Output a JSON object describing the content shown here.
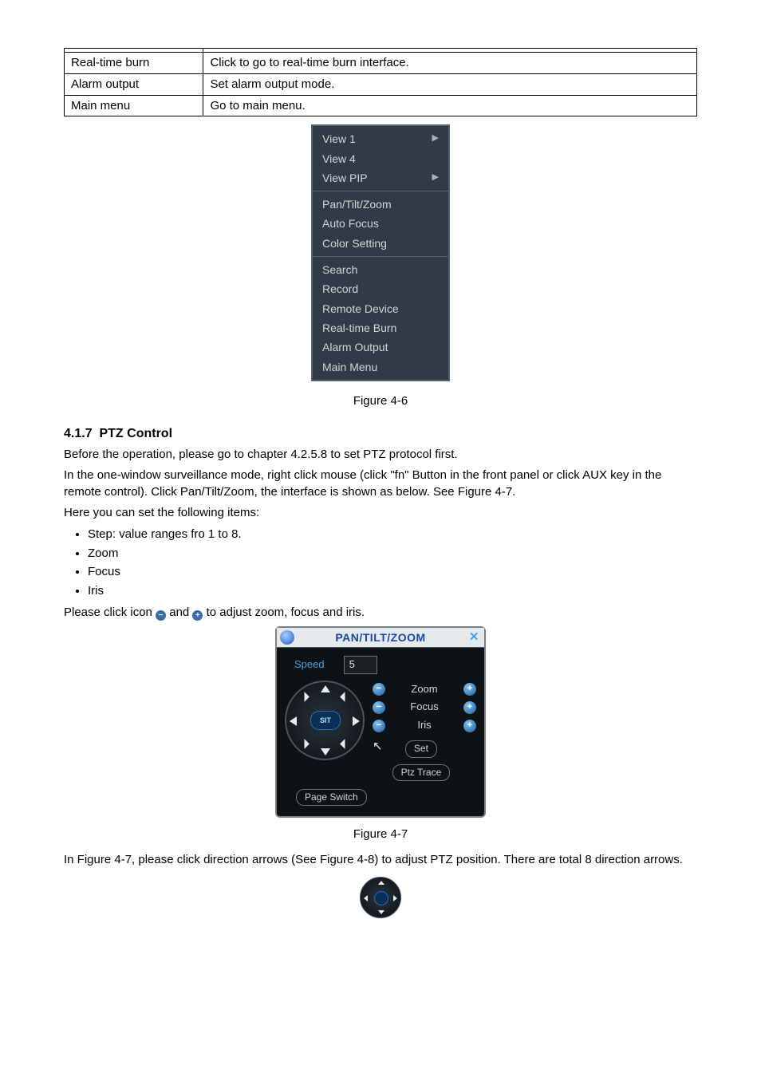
{
  "table": {
    "rows": [
      {
        "name": "Real-time burn",
        "desc": "Click to go to real-time burn interface."
      },
      {
        "name": "Alarm output",
        "desc": "Set alarm output mode."
      },
      {
        "name": "Main menu",
        "desc": "Go to main menu."
      }
    ]
  },
  "context_menu": {
    "groups": [
      [
        {
          "label": "View 1",
          "has_sub": true
        },
        {
          "label": "View 4",
          "has_sub": false
        },
        {
          "label": "View PIP",
          "has_sub": true
        }
      ],
      [
        {
          "label": "Pan/Tilt/Zoom",
          "has_sub": false
        },
        {
          "label": "Auto Focus",
          "has_sub": false
        },
        {
          "label": "Color Setting",
          "has_sub": false
        }
      ],
      [
        {
          "label": "Search",
          "has_sub": false
        },
        {
          "label": "Record",
          "has_sub": false
        },
        {
          "label": "Remote Device",
          "has_sub": false
        },
        {
          "label": "Real-time Burn",
          "has_sub": false
        },
        {
          "label": "Alarm Output",
          "has_sub": false
        },
        {
          "label": "Main Menu",
          "has_sub": false
        }
      ]
    ]
  },
  "fig46": "Figure 4-6",
  "section": {
    "num": "4.1.7",
    "title": "PTZ Control"
  },
  "para1": "Before the operation, please go to chapter 4.2.5.8 to set PTZ protocol first.",
  "para2": "In the one-window surveillance mode, right click mouse (click \"fn\" Button in the front panel or click AUX key in the remote control). Click Pan/Tilt/Zoom, the interface is shown as below. See Figure 4-7.",
  "para3": "Here you can set the following items:",
  "bullets": [
    "Step: value ranges fro 1 to 8.",
    "Zoom",
    "Focus",
    "Iris"
  ],
  "para4a": "Please click icon ",
  "para4b": " and ",
  "para4c": " to adjust zoom, focus and iris.",
  "ptz": {
    "title": "PAN/TILT/ZOOM",
    "speed_label": "Speed",
    "speed_value": "5",
    "zoom": "Zoom",
    "focus": "Focus",
    "iris": "Iris",
    "set": "Set",
    "ptz_trace": "Ptz Trace",
    "page_switch": "Page Switch",
    "sit": "SIT"
  },
  "fig47": "Figure 4-7",
  "para5": "In Figure 4-7, please click direction arrows (See Figure 4-8) to adjust PTZ position. There are total 8 direction arrows."
}
